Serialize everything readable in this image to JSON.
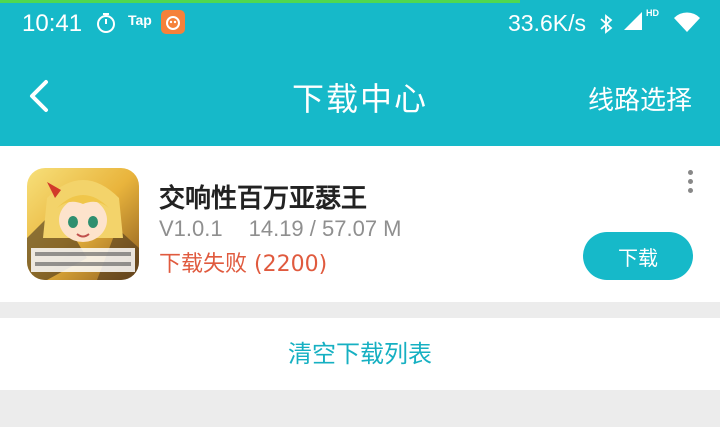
{
  "status_bar": {
    "time": "10:41",
    "tap_label": "Tap",
    "net_speed": "33.6K/s",
    "hd_label": "HD",
    "icons": [
      "timer-icon",
      "taptap-app-icon",
      "bluetooth-icon",
      "signal-icon",
      "wifi-icon"
    ]
  },
  "header": {
    "title": "下载中心",
    "route_select_label": "线路选择"
  },
  "download_item": {
    "title": "交响性百万亚瑟王",
    "version": "V1.0.1",
    "size": "14.19 / 57.07 M",
    "status": "下载失败 (2200)",
    "button_label": "下载",
    "status_color": "#e05a3e"
  },
  "list_actions": {
    "clear_label": "清空下载列表"
  },
  "colors": {
    "accent": "#16b9c9",
    "progress": "#4fd84f",
    "app_icon": "#f5813a"
  }
}
